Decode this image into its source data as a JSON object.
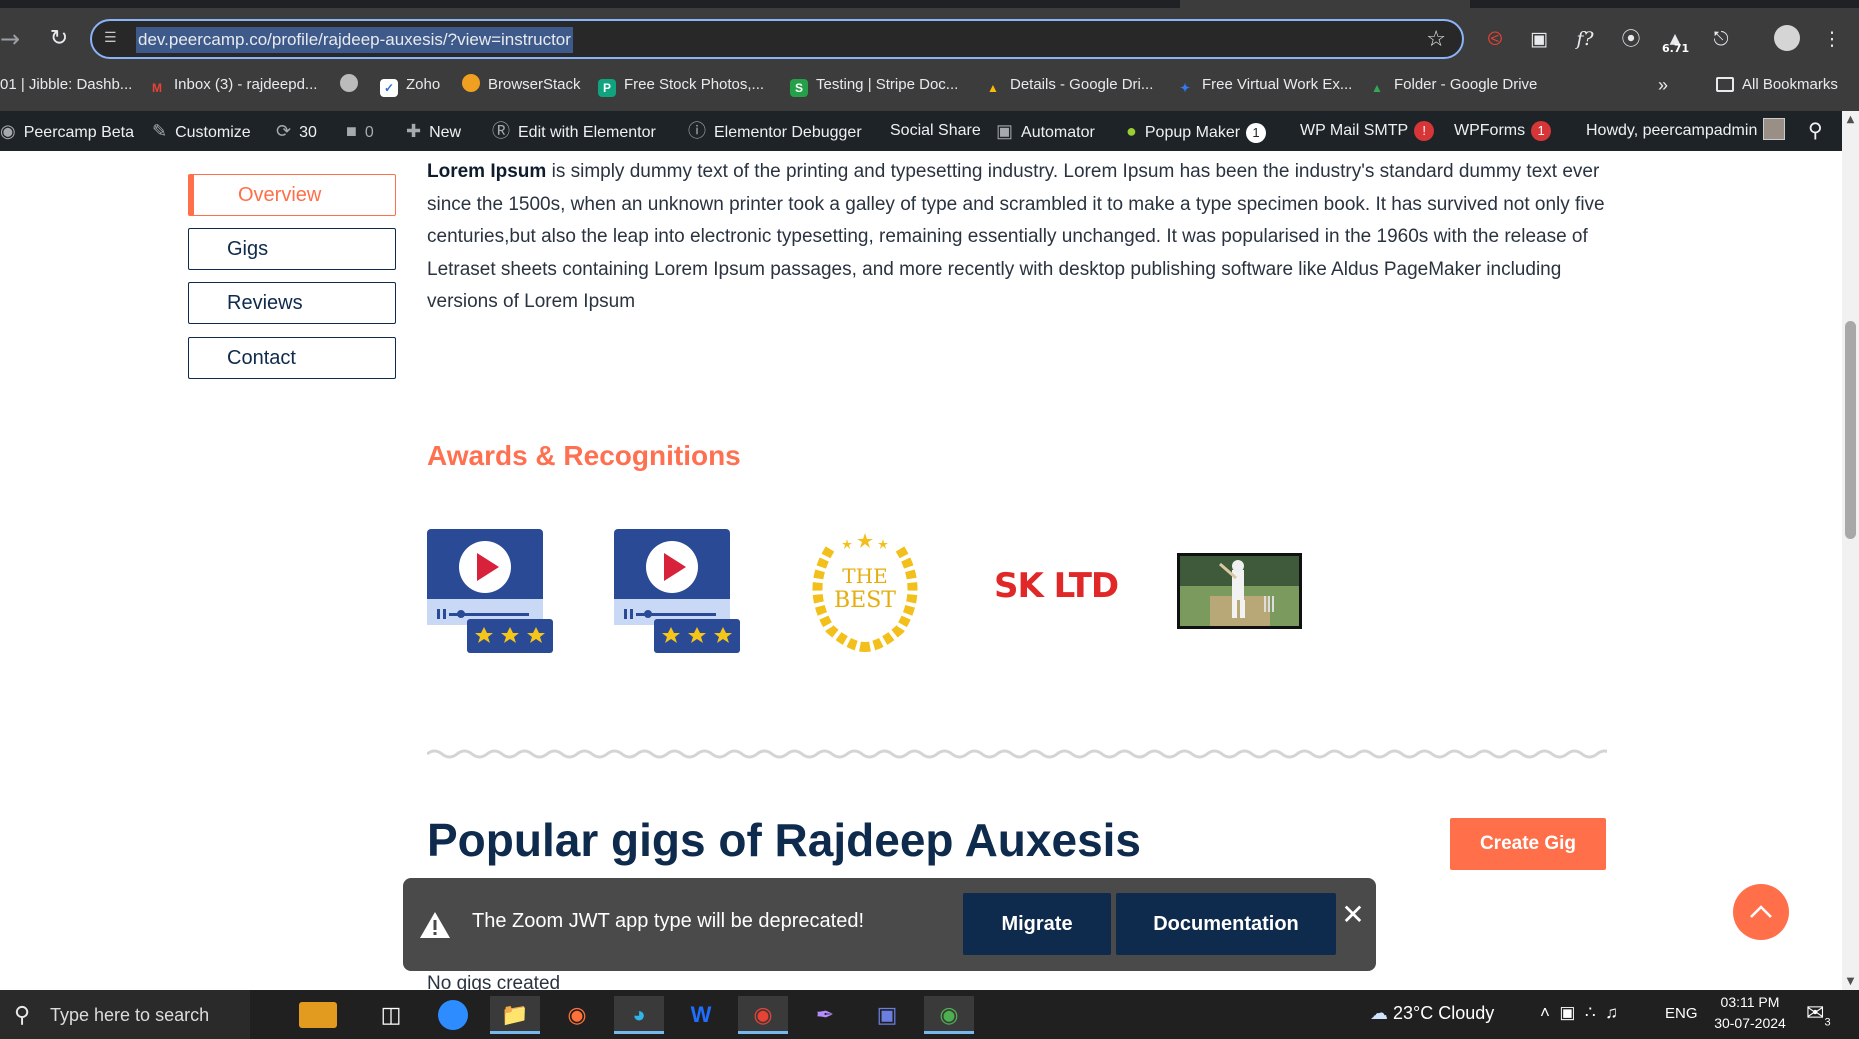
{
  "browser": {
    "url": "dev.peercamp.co/profile/rajdeep-auxesis/?view=instructor",
    "extension_badge": "6.71",
    "bookmarks": [
      {
        "label": "01 | Jibble: Dashb...",
        "color": "#3d7be0",
        "icon": "J"
      },
      {
        "label": "Inbox (3) - rajdeepd...",
        "color": "#ea4335",
        "icon": "M"
      },
      {
        "label": "",
        "color": "#888888",
        "icon": "●"
      },
      {
        "label": "Zoho",
        "color": "#2f6fd8",
        "icon": "Z"
      },
      {
        "label": "BrowserStack",
        "color": "#f0a020",
        "icon": "B"
      },
      {
        "label": "Free Stock Photos,...",
        "color": "#10a37f",
        "icon": "P"
      },
      {
        "label": "Testing | Stripe Doc...",
        "color": "#24a148",
        "icon": "S"
      },
      {
        "label": "Details - Google Dri...",
        "color": "#fbbc04",
        "icon": "▲"
      },
      {
        "label": "Free Virtual Work Ex...",
        "color": "#3478f6",
        "icon": "✦"
      },
      {
        "label": "Folder - Google Drive",
        "color": "#34a853",
        "icon": "▲"
      }
    ],
    "bookmarks_overflow": "»",
    "all_bookmarks": "All Bookmarks"
  },
  "adminbar": {
    "site": "Peercamp Beta",
    "customize": "Customize",
    "updates": "30",
    "comments": "0",
    "new": "New",
    "elementor": "Edit with Elementor",
    "debugger": "Elementor Debugger",
    "social": "Social Share",
    "automator": "Automator",
    "popup": "Popup Maker",
    "popup_count": "1",
    "smtp": "WP Mail SMTP",
    "smtp_badge": "!",
    "wpforms": "WPForms",
    "wpforms_count": "1",
    "howdy": "Howdy, peercampadmin"
  },
  "profile": {
    "tabs": [
      "Overview",
      "Gigs",
      "Reviews",
      "Contact"
    ],
    "about_bold": "Lorem Ipsum",
    "about_text": " is simply dummy text of the printing and typesetting industry. Lorem Ipsum has been the industry's standard dummy text ever since the 1500s, when an unknown printer took a galley of type and scrambled it to make a type specimen book. It has survived not only five centuries,but also the leap into electronic typesetting, remaining essentially unchanged. It was popularised in the 1960s with the release of Letraset sheets containing Lorem Ipsum passages, and more recently with desktop publishing software like Aldus PageMaker including versions of Lorem Ipsum",
    "awards_title": "Awards & Recognitions",
    "award_best_line1": "THE",
    "award_best_line2": "BEST",
    "award_logo_text": "SK LTD",
    "gigs_title": "Popular gigs of Rajdeep Auxesis",
    "create_gig": "Create Gig",
    "no_gigs": "No gigs created"
  },
  "zoom_notice": {
    "message": "The Zoom JWT app type will be deprecated!",
    "migrate": "Migrate",
    "documentation": "Documentation"
  },
  "taskbar": {
    "search_placeholder": "Type here to search",
    "weather": "23°C  Cloudy",
    "lang": "ENG",
    "time": "03:11 PM",
    "date": "30-07-2024",
    "notifications": "3"
  },
  "colors": {
    "accent": "#ff6f4a",
    "navy": "#0e2a4c"
  }
}
